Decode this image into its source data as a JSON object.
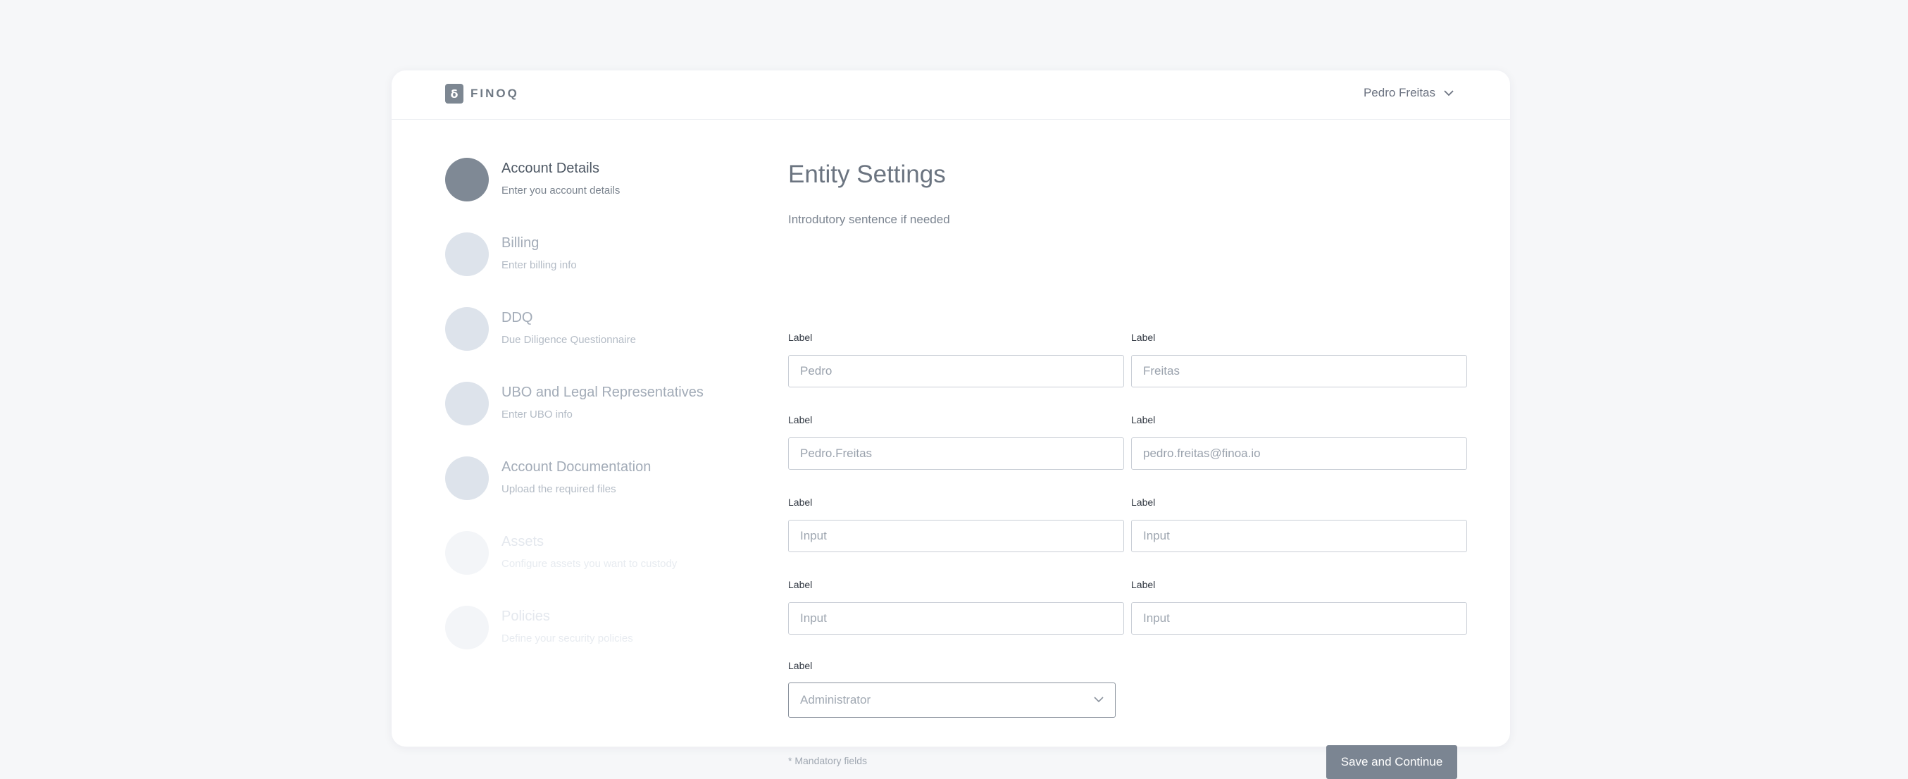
{
  "header": {
    "logo_mark": "δ",
    "logo_text": "FINOQ",
    "user_name": "Pedro Freitas",
    "user_menu_icon": "chevron-down-icon"
  },
  "steps": [
    {
      "title": "Account Details",
      "subtitle": "Enter you account details",
      "state": "active"
    },
    {
      "title": "Billing",
      "subtitle": "Enter billing info",
      "state": "pending"
    },
    {
      "title": "DDQ",
      "subtitle": "Due Diligence Questionnaire",
      "state": "pending"
    },
    {
      "title": "UBO and Legal Representatives",
      "subtitle": "Enter UBO info",
      "state": "pending"
    },
    {
      "title": "Account Documentation",
      "subtitle": "Upload the required files",
      "state": "pending"
    },
    {
      "title": "Assets",
      "subtitle": "Configure assets you want to custody",
      "state": "disabled"
    },
    {
      "title": "Policies",
      "subtitle": "Define your security policies",
      "state": "disabled"
    }
  ],
  "form": {
    "title": "Entity Settings",
    "intro": "Introdutory sentence if needed",
    "fields": [
      {
        "label": "Label",
        "value": "Pedro",
        "placeholder": ""
      },
      {
        "label": "Label",
        "value": "Freitas",
        "placeholder": ""
      },
      {
        "label": "Label",
        "value": "Pedro.Freitas",
        "placeholder": ""
      },
      {
        "label": "Label",
        "value": "pedro.freitas@finoa.io",
        "placeholder": ""
      },
      {
        "label": "Label",
        "value": "",
        "placeholder": "Input"
      },
      {
        "label": "Label",
        "value": "",
        "placeholder": "Input"
      },
      {
        "label": "Label",
        "value": "",
        "placeholder": "Input"
      },
      {
        "label": "Label",
        "value": "",
        "placeholder": "Input"
      }
    ],
    "select": {
      "label": "Label",
      "value": "Administrator"
    },
    "mandatory_note": "* Mandatory fields",
    "save_label": "Save and Continue"
  },
  "colors": {
    "page_background": "#f6f7f9",
    "card_background": "#ffffff",
    "active_step": "#7f8995",
    "pending_step": "#dde3eb",
    "disabled_step": "#f3f5f8",
    "primary_button": "#7b8592"
  }
}
